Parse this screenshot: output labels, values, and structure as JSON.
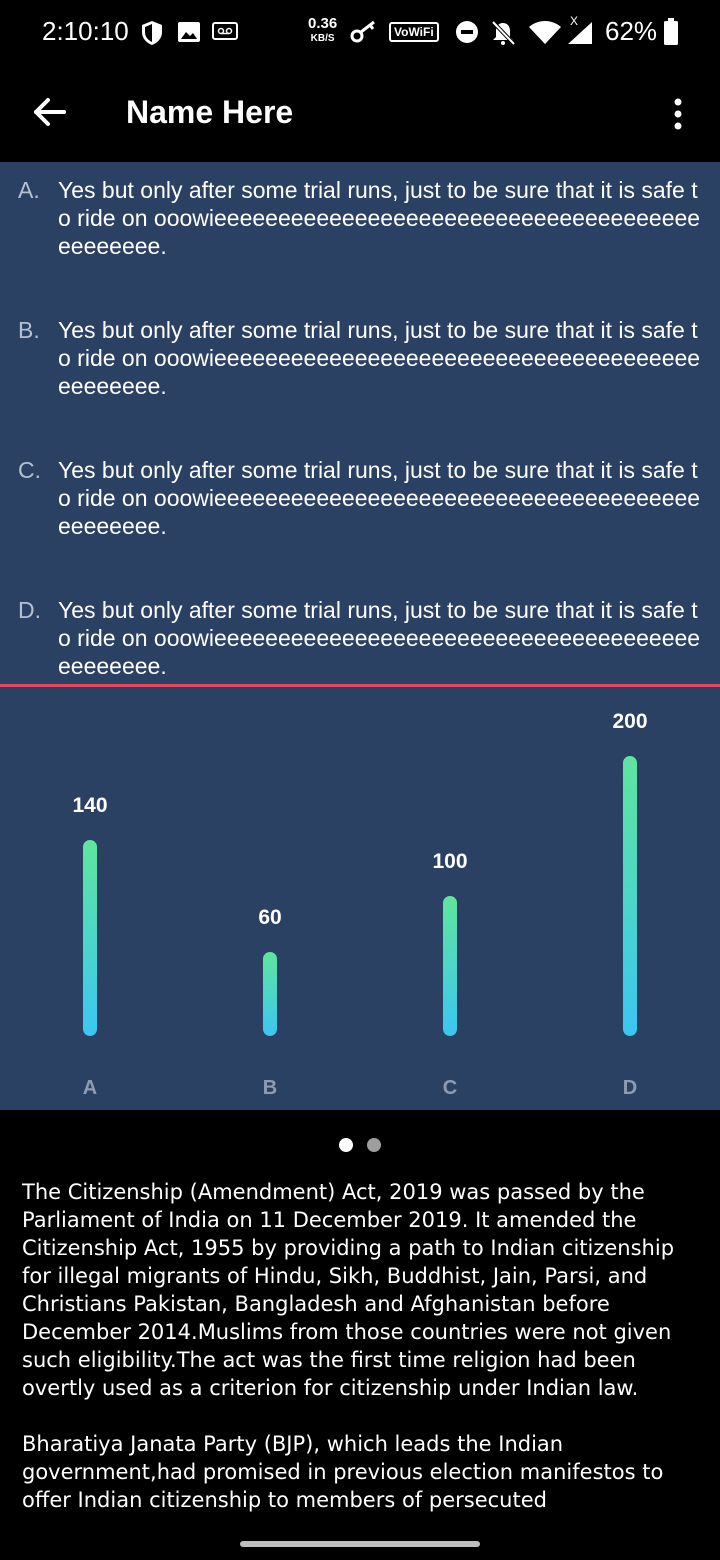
{
  "status_bar": {
    "time": "2:10:10",
    "net_speed_value": "0.36",
    "net_speed_unit": "KB/S",
    "vowifi_label": "VoWiFi",
    "signal_badge": "X",
    "battery_percent": "62%",
    "icons": [
      "shield-icon",
      "image-icon",
      "voicemail-icon",
      "key-icon",
      "dnd-icon",
      "bell-off-icon",
      "wifi-icon",
      "signal-icon",
      "battery-icon"
    ]
  },
  "app_bar": {
    "title": "Name Here",
    "icons": [
      "back-arrow-icon",
      "more-vert-icon"
    ]
  },
  "options": [
    {
      "letter": "A.",
      "text": "Yes but only after some trial runs, just to be sure that it is safe to ride on ooowieeeeeeeeeeeeeeeeeeeeeeeeeeeeeeeeeeeeeeeeeeeeee."
    },
    {
      "letter": "B.",
      "text": "Yes but only after some trial runs, just to be sure that it is safe to ride on ooowieeeeeeeeeeeeeeeeeeeeeeeeeeeeeeeeeeeeeeeeeeeeee."
    },
    {
      "letter": "C.",
      "text": "Yes but only after some trial runs, just to be sure that it is safe to ride on ooowieeeeeeeeeeeeeeeeeeeeeeeeeeeeeeeeeeeeeeeeeeeeee."
    },
    {
      "letter": "D.",
      "text": "Yes but only after some trial runs, just to be sure that it is safe to ride on ooowieeeeeeeeeeeeeeeeeeeeeeeeeeeeeeeeeeeeeeeeeeeeee."
    }
  ],
  "chart_data": {
    "type": "bar",
    "categories": [
      "A",
      "B",
      "C",
      "D"
    ],
    "values": [
      140,
      60,
      100,
      200
    ],
    "gradient_top": "#5fe59d",
    "gradient_bottom": "#3bc6f2",
    "label_color": "#ffffff",
    "category_color": "#8e9bb3"
  },
  "pager": {
    "count": 2,
    "active": 0,
    "active_color": "#ffffff",
    "inactive_color": "#9e9e9e"
  },
  "article": {
    "paragraphs": [
      "The Citizenship (Amendment) Act, 2019 was passed by the Parliament of India on 11 December 2019. It amended the Citizenship Act, 1955 by providing a path to Indian citizenship for illegal migrants of Hindu, Sikh, Buddhist, Jain, Parsi, and Christians Pakistan, Bangladesh and Afghanistan before December 2014.Muslims from those countries were not given such eligibility.The act was the first time religion had been overtly used as a criterion for citizenship under Indian law.",
      "Bharatiya Janata Party (BJP), which leads the Indian government,had promised in previous election manifestos to offer Indian citizenship to members of persecuted"
    ]
  },
  "colors": {
    "panel": "#2b4164",
    "divider": "#e5485f"
  }
}
